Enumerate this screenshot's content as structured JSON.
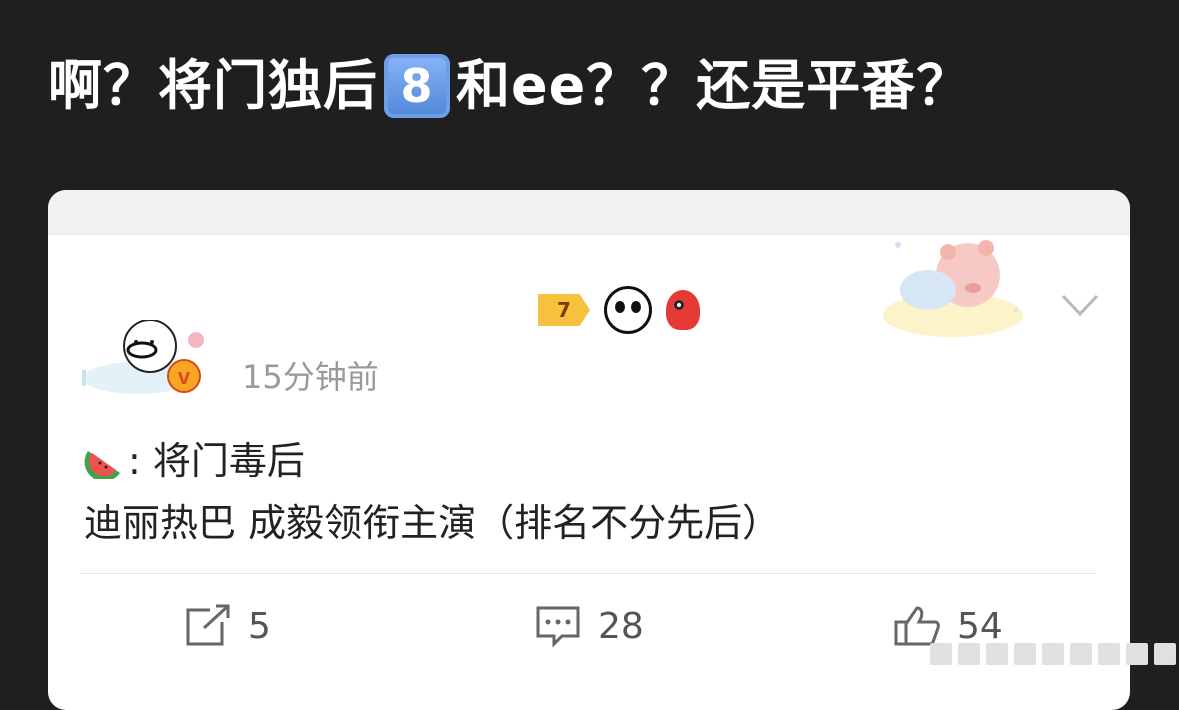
{
  "headline": {
    "part1": "啊？将门独后",
    "keycap": "8",
    "part2": "和ee？？还是平番？"
  },
  "post": {
    "badges": [
      "tag-7-badge",
      "panda-badge",
      "red-bird-badge"
    ],
    "badge_tag_text": "7",
    "timestamp": "15分钟前",
    "lines": [
      {
        "prefix_icon": "watermelon-icon",
        "text": ": 将门毒后"
      },
      {
        "text": "迪丽热巴 成毅领衔主演（排名不分先后）"
      }
    ],
    "actions": {
      "repost_count": "5",
      "comment_count": "28",
      "like_count": "54"
    }
  },
  "colors": {
    "background": "#1f1f21",
    "card": "#ffffff",
    "muted_text": "#9a9a9a",
    "verified": "#e8620c"
  }
}
